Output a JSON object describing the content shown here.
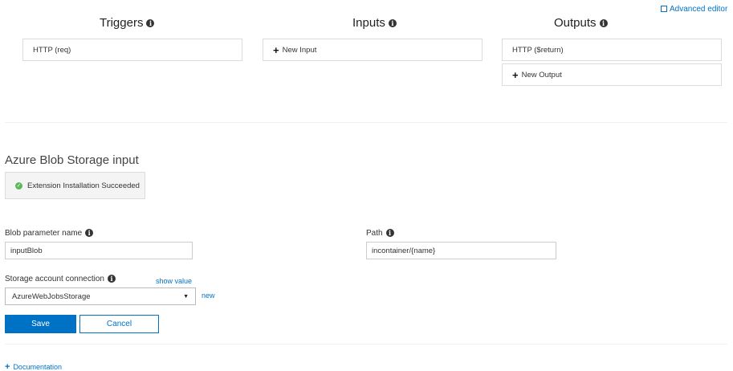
{
  "header": {
    "advanced_editor": "Advanced editor",
    "triggers_title": "Triggers",
    "inputs_title": "Inputs",
    "outputs_title": "Outputs"
  },
  "triggers": [
    {
      "label": "HTTP (req)"
    }
  ],
  "inputs": {
    "new_label": "New Input"
  },
  "outputs": {
    "items": [
      {
        "label": "HTTP ($return)"
      }
    ],
    "new_label": "New Output"
  },
  "form": {
    "title": "Azure Blob Storage input",
    "extension_status": "Extension Installation Succeeded",
    "blob_param_label": "Blob parameter name",
    "blob_param_value": "inputBlob",
    "path_label": "Path",
    "path_value": "incontainer/{name}",
    "storage_label": "Storage account connection",
    "show_value": "show value",
    "storage_value": "AzureWebJobsStorage",
    "new_link": "new",
    "save": "Save",
    "cancel": "Cancel"
  },
  "footer": {
    "documentation": "Documentation"
  },
  "colors": {
    "accent": "#0072c6",
    "success": "#5cb85c"
  }
}
